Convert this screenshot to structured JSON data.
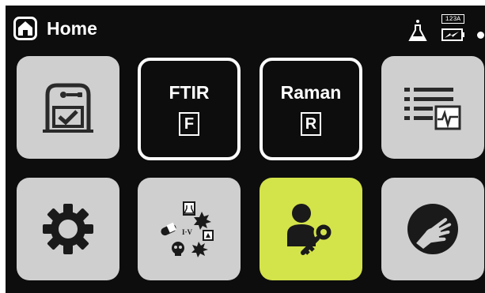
{
  "header": {
    "title": "Home",
    "home_icon": "home-icon",
    "status": {
      "flask_icon": "flask-icon",
      "battery_label": "123A",
      "battery_icon": "battery-charging-icon"
    }
  },
  "tiles": [
    {
      "name": "protocol",
      "icon": "clipboard-check-icon",
      "color": "#cfcfcf"
    },
    {
      "name": "ftir",
      "label": "FTIR",
      "letter": "F",
      "color": "#0d0d0d"
    },
    {
      "name": "raman",
      "label": "Raman",
      "letter": "R",
      "color": "#0d0d0d"
    },
    {
      "name": "results",
      "icon": "list-chart-icon",
      "color": "#cfcfcf"
    },
    {
      "name": "settings",
      "icon": "gear-icon",
      "color": "#cfcfcf"
    },
    {
      "name": "hazard",
      "icon": "hazard-symbols-icon",
      "icon_text": "I·V",
      "color": "#cfcfcf"
    },
    {
      "name": "user",
      "icon": "user-key-icon",
      "color": "#d3e34a"
    },
    {
      "name": "help",
      "icon": "hand-help-icon",
      "color": "#cfcfcf"
    }
  ],
  "colors": {
    "background": "#0d0d0d",
    "tile_gray": "#cfcfcf",
    "accent": "#d3e34a",
    "text": "#ffffff"
  }
}
